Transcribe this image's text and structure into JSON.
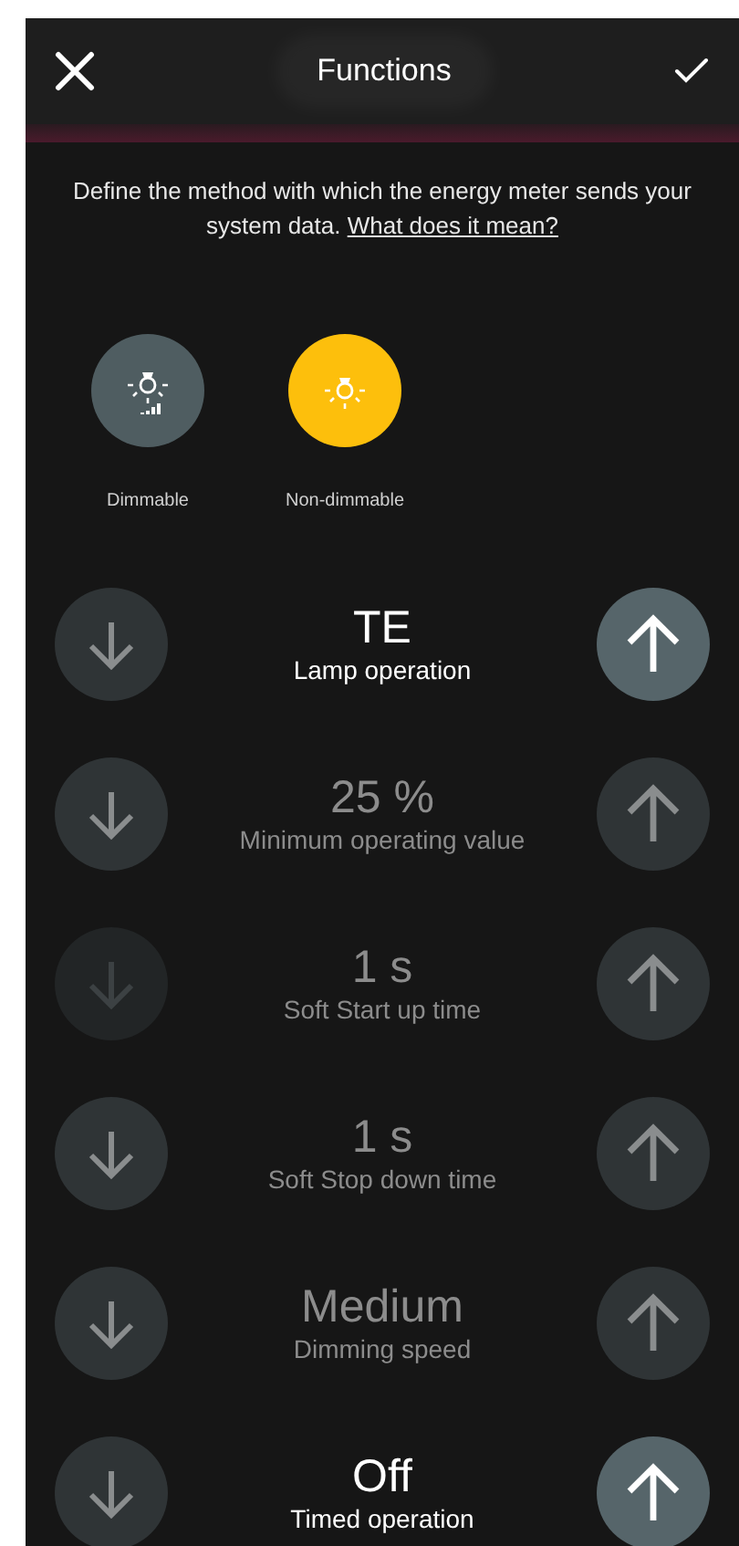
{
  "header": {
    "title": "Functions"
  },
  "intro": {
    "text": "Define the method with which the energy meter sends your system data.",
    "link": "What does it mean?"
  },
  "lamp_types": [
    {
      "label": "Dimmable",
      "kind": "dimmable",
      "selected": false
    },
    {
      "label": "Non-dimmable",
      "kind": "plain",
      "selected": true
    }
  ],
  "settings": [
    {
      "value": "TE",
      "label": "Lamp operation",
      "highlighted": true,
      "down_disabled": false
    },
    {
      "value": "25 %",
      "label": "Minimum operating value",
      "highlighted": false,
      "down_disabled": false
    },
    {
      "value": "1 s",
      "label": "Soft Start up time",
      "highlighted": false,
      "down_disabled": true
    },
    {
      "value": "1 s",
      "label": "Soft Stop down time",
      "highlighted": false,
      "down_disabled": false
    },
    {
      "value": "Medium",
      "label": "Dimming speed",
      "highlighted": false,
      "down_disabled": false
    },
    {
      "value": "Off",
      "label": "Timed operation",
      "highlighted": true,
      "down_disabled": false
    }
  ]
}
